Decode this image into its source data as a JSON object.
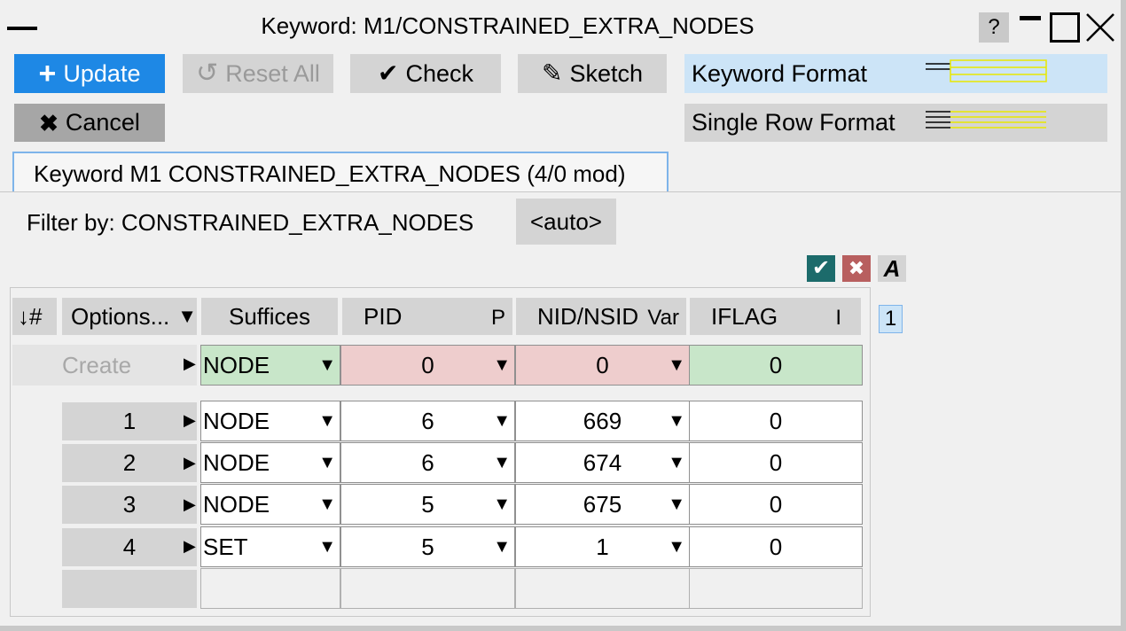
{
  "window": {
    "title": "Keyword: M1/CONSTRAINED_EXTRA_NODES",
    "help_label": "?"
  },
  "toolbar": {
    "update_label": "Update",
    "reset_label": "Reset All",
    "check_label": "Check",
    "sketch_label": "Sketch",
    "cancel_label": "Cancel",
    "keyword_format_label": "Keyword Format",
    "single_row_format_label": "Single Row Format"
  },
  "tab": {
    "label": "Keyword M1 CONSTRAINED_EXTRA_NODES (4/0 mod)"
  },
  "filter": {
    "label": "Filter by: CONSTRAINED_EXTRA_NODES",
    "auto_label": "<auto>"
  },
  "table_tools": {
    "accept_icon": "check-icon",
    "reject_icon": "cross-icon",
    "font_label": "A"
  },
  "table": {
    "headers": {
      "sort": "↓#",
      "options": "Options...",
      "options_arrow": "▼",
      "suffices": "Suffices",
      "pid": "PID",
      "pid_sub": "P",
      "nid": "NID/NSID",
      "nid_sub": "Var",
      "iflag": "IFLAG",
      "iflag_sub": "I"
    },
    "page_number": "1",
    "create_row": {
      "label": "Create",
      "suffix": "NODE",
      "pid": "0",
      "nid": "0",
      "iflag": "0"
    },
    "rows": [
      {
        "num": "1",
        "suffix": "NODE",
        "pid": "6",
        "nid": "669",
        "iflag": "0"
      },
      {
        "num": "2",
        "suffix": "NODE",
        "pid": "6",
        "nid": "674",
        "iflag": "0"
      },
      {
        "num": "3",
        "suffix": "NODE",
        "pid": "5",
        "nid": "675",
        "iflag": "0"
      },
      {
        "num": "4",
        "suffix": "SET",
        "pid": "5",
        "nid": "1",
        "iflag": "0"
      }
    ]
  }
}
